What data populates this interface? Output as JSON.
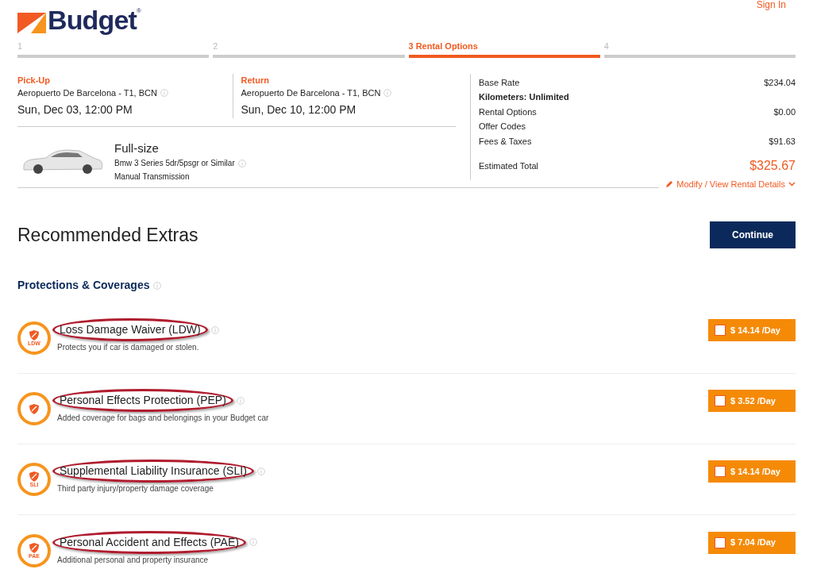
{
  "header": {
    "brand": "Budget",
    "registered": "®",
    "sign_in": "Sign In"
  },
  "steps": [
    {
      "label": "1",
      "selected": false
    },
    {
      "label": "2",
      "selected": false
    },
    {
      "label": "3 Rental Options",
      "selected": true
    },
    {
      "label": "4",
      "selected": false
    }
  ],
  "pickup": {
    "label": "Pick-Up",
    "location": "Aeropuerto De Barcelona - T1, BCN",
    "datetime": "Sun, Dec 03, 12:00 PM"
  },
  "return": {
    "label": "Return",
    "location": "Aeropuerto De Barcelona - T1, BCN",
    "datetime": "Sun, Dec 10, 12:00 PM"
  },
  "vehicle": {
    "class": "Full-size",
    "model": "Bmw 3 Series 5dr/5psgr or Similar",
    "transmission": "Manual Transmission"
  },
  "summary": {
    "rows": [
      {
        "label": "Base Rate",
        "value": "$234.04",
        "kind": "line"
      },
      {
        "label": "Kilometers: Unlimited",
        "kind": "note"
      },
      {
        "label": "Rental Options",
        "value": "$0.00",
        "kind": "line"
      },
      {
        "label": "Offer Codes",
        "kind": "line"
      },
      {
        "label": "Fees & Taxes",
        "value": "$91.63",
        "kind": "line"
      }
    ],
    "total_label": "Estimated Total",
    "total": "$325.67",
    "modify_link": "Modify / View Rental Details"
  },
  "heading": "Recommended Extras",
  "continue_button": "Continue",
  "section": "Protections & Coverages",
  "extras": [
    {
      "title": "Loss Damage Waiver (LDW)",
      "description": "Protects you if car is damaged or stolen.",
      "badge": "LDW",
      "price": "$ 14.14 /Day",
      "checked": false,
      "highlighted": true
    },
    {
      "title": "Personal Effects Protection (PEP)",
      "description": "Added coverage for bags and belongings in your Budget car",
      "price": "$ 3.52 /Day",
      "checked": false,
      "highlighted": true
    },
    {
      "title": "Supplemental Liability Insurance (SLI)",
      "description": "Third party injury/property damage coverage",
      "badge": "SLI",
      "price": "$ 14.14 /Day",
      "checked": false,
      "highlighted": true
    },
    {
      "title": "Personal Accident and Effects (PAE)",
      "description": "Additional personal and property insurance",
      "badge": "PAE",
      "price": "$ 7.04 /Day",
      "checked": false,
      "highlighted": true
    }
  ]
}
